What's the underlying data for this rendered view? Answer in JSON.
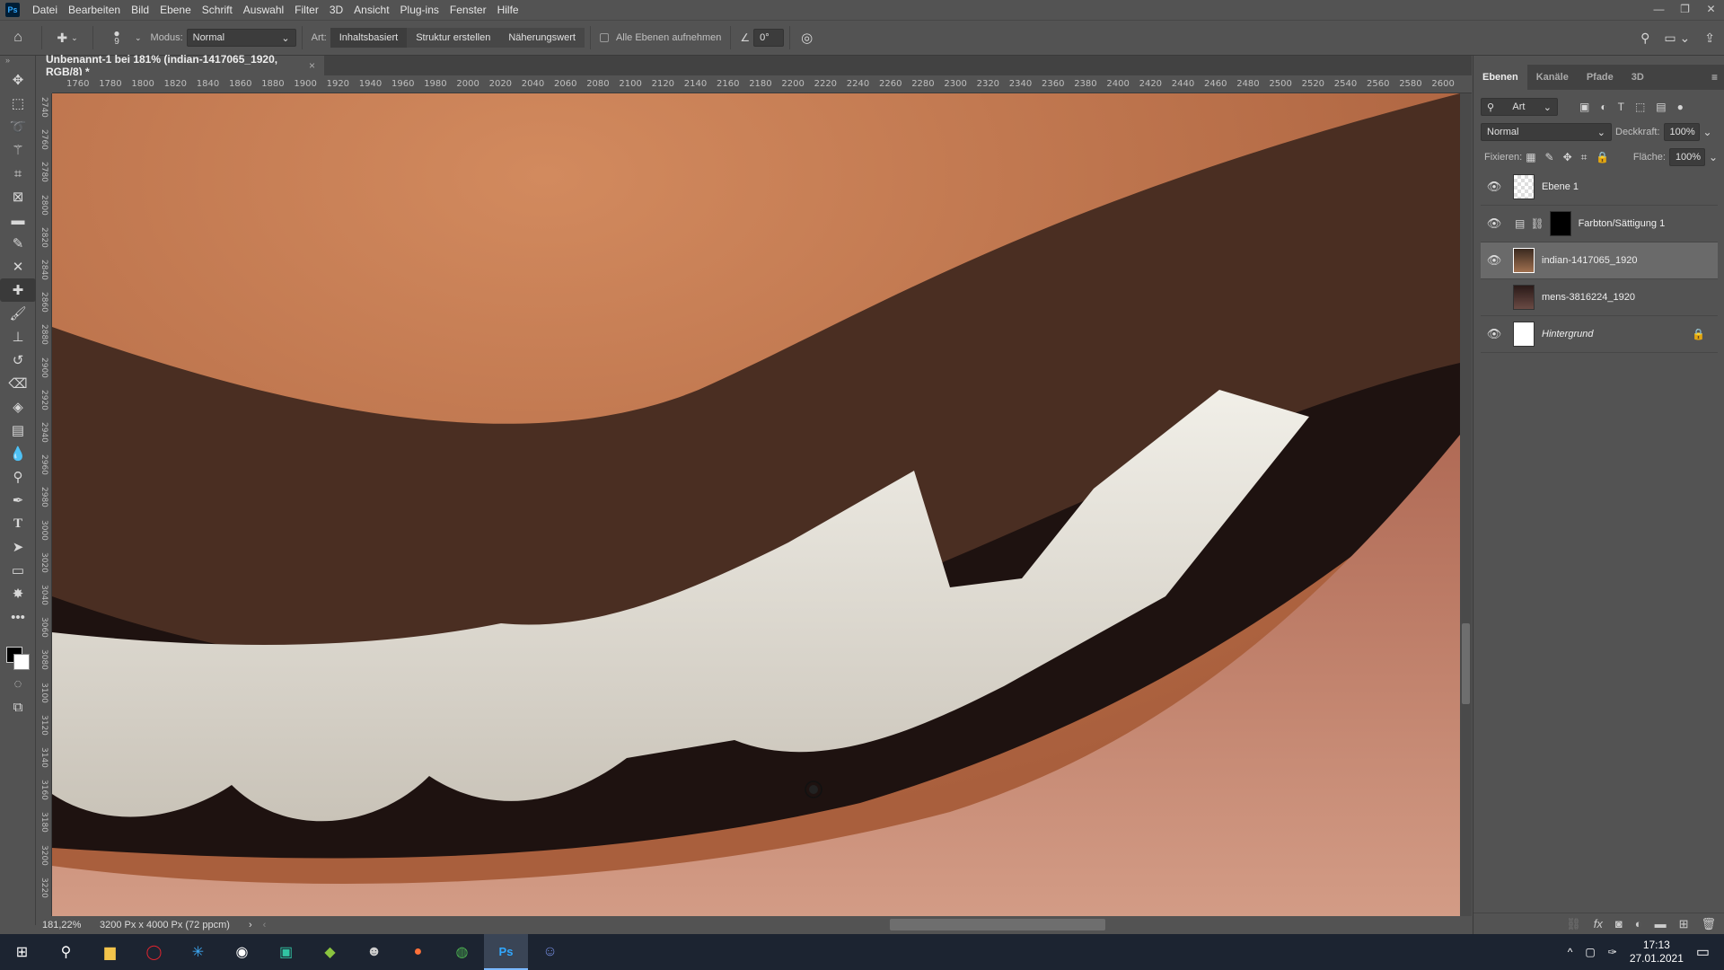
{
  "app": {
    "logo": "Ps",
    "menu": [
      "Datei",
      "Bearbeiten",
      "Bild",
      "Ebene",
      "Schrift",
      "Auswahl",
      "Filter",
      "3D",
      "Ansicht",
      "Plug-ins",
      "Fenster",
      "Hilfe"
    ]
  },
  "window_controls": {
    "minimize": "—",
    "restore": "❐",
    "close": "✕"
  },
  "options": {
    "brush_size": "9",
    "mode_label": "Modus:",
    "mode_value": "Normal",
    "type_label": "Art:",
    "type_buttons": [
      "Inhaltsbasiert",
      "Struktur erstellen",
      "Näherungswert"
    ],
    "type_selected": "Inhaltsbasiert",
    "sample_all_layers": "Alle Ebenen aufnehmen",
    "sample_all_checked": false,
    "angle": "0°"
  },
  "document": {
    "tab_title": "Unbenannt-1 bei 181% (indian-1417065_1920, RGB/8) *",
    "h_ruler": [
      "1760",
      "1780",
      "1800",
      "1820",
      "1840",
      "1860",
      "1880",
      "1900",
      "1920",
      "1940",
      "1960",
      "1980",
      "2000",
      "2020",
      "2040",
      "2060",
      "2080",
      "2100",
      "2120",
      "2140",
      "2160",
      "2180",
      "2200",
      "2220",
      "2240",
      "2260",
      "2280",
      "2300",
      "2320",
      "2340",
      "2360",
      "2380",
      "2400",
      "2420",
      "2440",
      "2460",
      "2480",
      "2500",
      "2520",
      "2540",
      "2560",
      "2580",
      "2600"
    ],
    "v_ruler": [
      "2740",
      "2760",
      "2780",
      "2800",
      "2820",
      "2840",
      "2860",
      "2880",
      "2900",
      "2920",
      "2940",
      "2960",
      "2980",
      "3000",
      "3020",
      "3040",
      "3060",
      "3080",
      "3100",
      "3120",
      "3140",
      "3160",
      "3180",
      "3200",
      "3220"
    ]
  },
  "status": {
    "zoom": "181,22%",
    "doc_info": "3200 Px x 4000 Px (72 ppcm)"
  },
  "tools": [
    "move",
    "marquee",
    "lasso",
    "magic-wand",
    "crop",
    "frame",
    "ruler",
    "eyedropper",
    "content-aware-move",
    "spot-healing-brush",
    "brush",
    "clone-stamp",
    "history-brush",
    "eraser",
    "paint-bucket",
    "gradient",
    "blur",
    "dodge",
    "pen",
    "type",
    "path-selection",
    "rectangle",
    "custom-shape",
    "more"
  ],
  "active_tool": "spot-healing-brush",
  "panel": {
    "tabs": [
      "Ebenen",
      "Kanäle",
      "Pfade",
      "3D"
    ],
    "active_tab": "Ebenen",
    "filter_label": "Art",
    "blend_mode": "Normal",
    "opacity_label": "Deckkraft:",
    "opacity": "100%",
    "lock_label": "Fixieren:",
    "fill_label": "Fläche:",
    "fill": "100%",
    "layers": [
      {
        "name": "Ebene 1",
        "visible": true,
        "type": "transparent"
      },
      {
        "name": "Farbton/Sättigung 1",
        "visible": true,
        "type": "adjustment"
      },
      {
        "name": "indian-1417065_1920",
        "visible": true,
        "type": "photo",
        "selected": true
      },
      {
        "name": "mens-3816224_1920",
        "visible": false,
        "type": "photo"
      },
      {
        "name": "Hintergrund",
        "visible": true,
        "type": "background",
        "locked": true
      }
    ]
  },
  "taskbar": {
    "apps": [
      "windows-start",
      "search",
      "file-explorer",
      "opera",
      "battle-net",
      "obs",
      "streamlabs",
      "bluestacks",
      "voicemod",
      "firefox",
      "chrome",
      "photoshop",
      "discord"
    ],
    "active_app": "photoshop",
    "time": "17:13",
    "date": "27.01.2021"
  }
}
